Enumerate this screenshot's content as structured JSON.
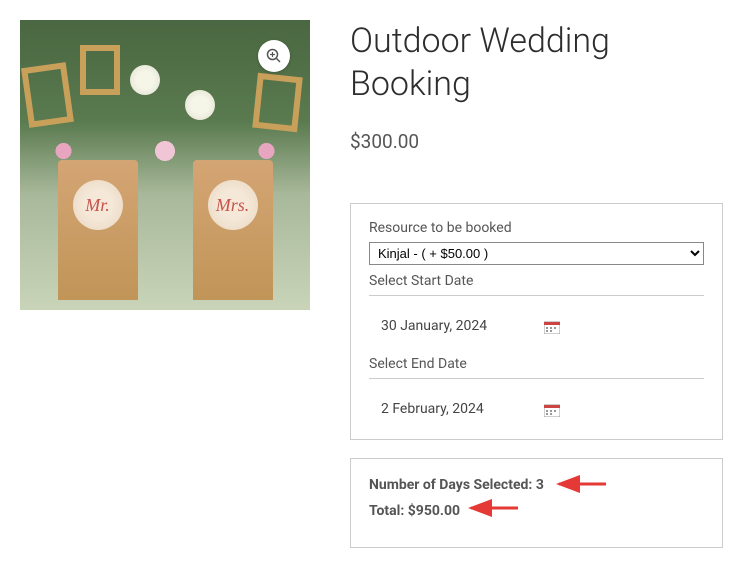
{
  "product": {
    "title": "Outdoor Wedding Booking",
    "price": "$300.00"
  },
  "booking": {
    "resource_label": "Resource to be booked",
    "resource_selected": "Kinjal - ( + $50.00 )",
    "start_label": "Select Start Date",
    "start_value": "30 January, 2024",
    "end_label": "Select End Date",
    "end_value": "2 February, 2024"
  },
  "summary": {
    "days_label": "Number of Days Selected: ",
    "days_value": "3",
    "total_label": "Total: ",
    "total_value": "$950.00"
  },
  "image": {
    "chair1": "Mr.",
    "chair2": "Mrs."
  }
}
